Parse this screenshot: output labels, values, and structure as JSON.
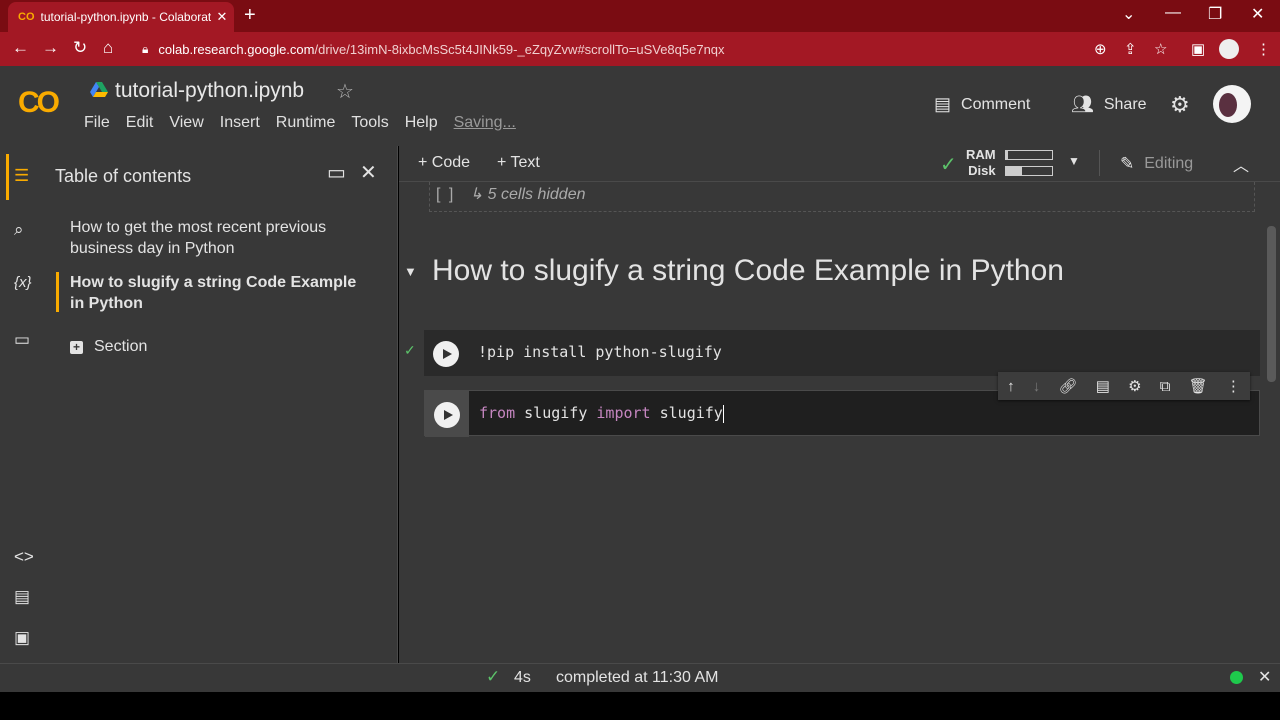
{
  "browser": {
    "tab_title": "tutorial-python.ipynb - Colaboratory",
    "tab_logo": "CO",
    "url_host": "colab.research.google.com",
    "url_path": "/drive/13imN-8ixbcMsSc5t4JINk59-_eZqyZvw#scrollTo=uSVe8q5e7nqx"
  },
  "header": {
    "logo": "CO",
    "title": "tutorial-python.ipynb",
    "menu": [
      "File",
      "Edit",
      "View",
      "Insert",
      "Runtime",
      "Tools",
      "Help"
    ],
    "saving": "Saving...",
    "comment_label": "Comment",
    "share_label": "Share"
  },
  "sidebar": {
    "title": "Table of contents",
    "items": [
      {
        "label": "How to get the most recent previous business day in Python"
      },
      {
        "label": "How to slugify a string Code Example in Python"
      }
    ],
    "section_label": "Section"
  },
  "toolbar": {
    "code_label": "+ Code",
    "text_label": "+ Text",
    "ram_label": "RAM",
    "disk_label": "Disk",
    "ram_usage": 0.05,
    "disk_usage": 0.35,
    "editing_label": "Editing"
  },
  "notebook": {
    "hidden_bracket": "[ ]",
    "hidden_cells": "↳ 5 cells hidden",
    "section_heading": "How to slugify a string Code Example in Python",
    "cell1_code": "!pip install python-slugify",
    "cell2_kw1": "from",
    "cell2_mod": " slugify ",
    "cell2_kw2": "import",
    "cell2_name": " slugify"
  },
  "status": {
    "duration": "4s",
    "message": "completed at 11:30 AM"
  }
}
